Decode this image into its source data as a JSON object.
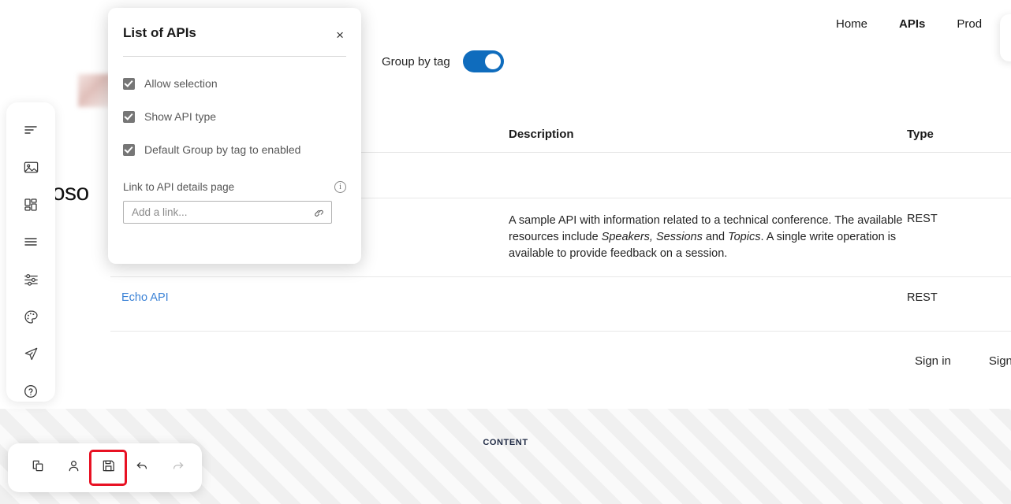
{
  "topnav": {
    "items": [
      {
        "label": "Home",
        "active": false
      },
      {
        "label": "APIs",
        "active": true
      },
      {
        "label": "Prod",
        "active": false
      }
    ]
  },
  "group_by_tag": {
    "label": "Group by tag",
    "enabled": true,
    "accent_color": "#0f6cbd"
  },
  "logo": {
    "text": "toso"
  },
  "table": {
    "headers": {
      "name": "",
      "description": "Description",
      "type": "Type"
    },
    "rows": [
      {
        "name": "",
        "description": "",
        "type": ""
      },
      {
        "name": "",
        "description_pre": "A sample API with information related to a technical conference. The available resources include ",
        "description_em1": "Speakers, Sessions",
        "description_mid": " and ",
        "description_em2": "Topics",
        "description_post": ". A single write operation is available to provide feedback on a session.",
        "type": "REST"
      },
      {
        "name": "Echo API",
        "description": "",
        "type": "REST"
      }
    ]
  },
  "auth": {
    "sign_in": "Sign in",
    "sign_up": "Sign"
  },
  "content_placeholder": {
    "label": "CONTENT"
  },
  "sidebar": {
    "items": [
      {
        "name": "text-align-icon",
        "label": "Pages"
      },
      {
        "name": "image-icon",
        "label": "Media"
      },
      {
        "name": "layout-grid-icon",
        "label": "Layouts"
      },
      {
        "name": "list-menu-icon",
        "label": "Navigation"
      },
      {
        "name": "settings-sliders-icon",
        "label": "Settings"
      },
      {
        "name": "palette-icon",
        "label": "Styles"
      },
      {
        "name": "paper-plane-icon",
        "label": "Publish"
      },
      {
        "name": "help-circle-icon",
        "label": "Help"
      }
    ]
  },
  "bottombar": {
    "buttons": [
      {
        "name": "duplicate-icon",
        "label": "Duplicate",
        "state": "normal"
      },
      {
        "name": "user-icon",
        "label": "Account",
        "state": "normal"
      },
      {
        "name": "save-icon",
        "label": "Save",
        "state": "selected"
      },
      {
        "name": "undo-icon",
        "label": "Undo",
        "state": "normal"
      },
      {
        "name": "redo-icon",
        "label": "Redo",
        "state": "disabled"
      }
    ],
    "selection_color": "#e81123"
  },
  "dialog": {
    "title": "List of APIs",
    "close_label": "×",
    "checkboxes": [
      {
        "label": "Allow selection",
        "checked": true
      },
      {
        "label": "Show API type",
        "checked": true
      },
      {
        "label": "Default Group by tag to enabled",
        "checked": true
      }
    ],
    "link_field": {
      "label": "Link to API details page",
      "placeholder": "Add a link...",
      "value": "",
      "info_glyph": "i"
    }
  }
}
